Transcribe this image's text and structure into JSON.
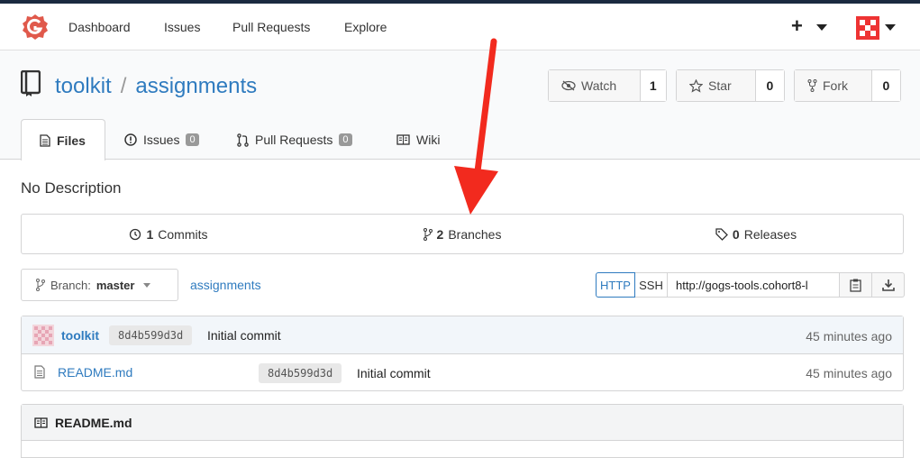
{
  "nav": {
    "items": [
      "Dashboard",
      "Issues",
      "Pull Requests",
      "Explore"
    ],
    "plus": "+"
  },
  "repo": {
    "owner": "toolkit",
    "separator": "/",
    "name": "assignments",
    "watch": {
      "label": "Watch",
      "count": "1"
    },
    "star": {
      "label": "Star",
      "count": "0"
    },
    "fork": {
      "label": "Fork",
      "count": "0"
    }
  },
  "tabs": {
    "files": "Files",
    "issues": {
      "label": "Issues",
      "count": "0"
    },
    "pulls": {
      "label": "Pull Requests",
      "count": "0"
    },
    "wiki": "Wiki"
  },
  "description": "No Description",
  "stats": {
    "commits": {
      "count": "1",
      "label": "Commits"
    },
    "branches": {
      "count": "2",
      "label": "Branches"
    },
    "releases": {
      "count": "0",
      "label": "Releases"
    }
  },
  "branch": {
    "prefix": "Branch:",
    "name": "master",
    "breadcrumb": "assignments"
  },
  "clone": {
    "http": "HTTP",
    "ssh": "SSH",
    "url": "http://gogs-tools.cohort8-l"
  },
  "latest_commit": {
    "author": "toolkit",
    "sha": "8d4b599d3d",
    "message": "Initial commit",
    "time": "45 minutes ago"
  },
  "files": [
    {
      "name": "README.md",
      "sha": "8d4b599d3d",
      "message": "Initial commit",
      "time": "45 minutes ago"
    }
  ],
  "readme": {
    "title": "README.md"
  },
  "colors": {
    "accent": "#2f7bbf",
    "logo": "#e0594b",
    "annotation_arrow": "#f22a1e"
  }
}
